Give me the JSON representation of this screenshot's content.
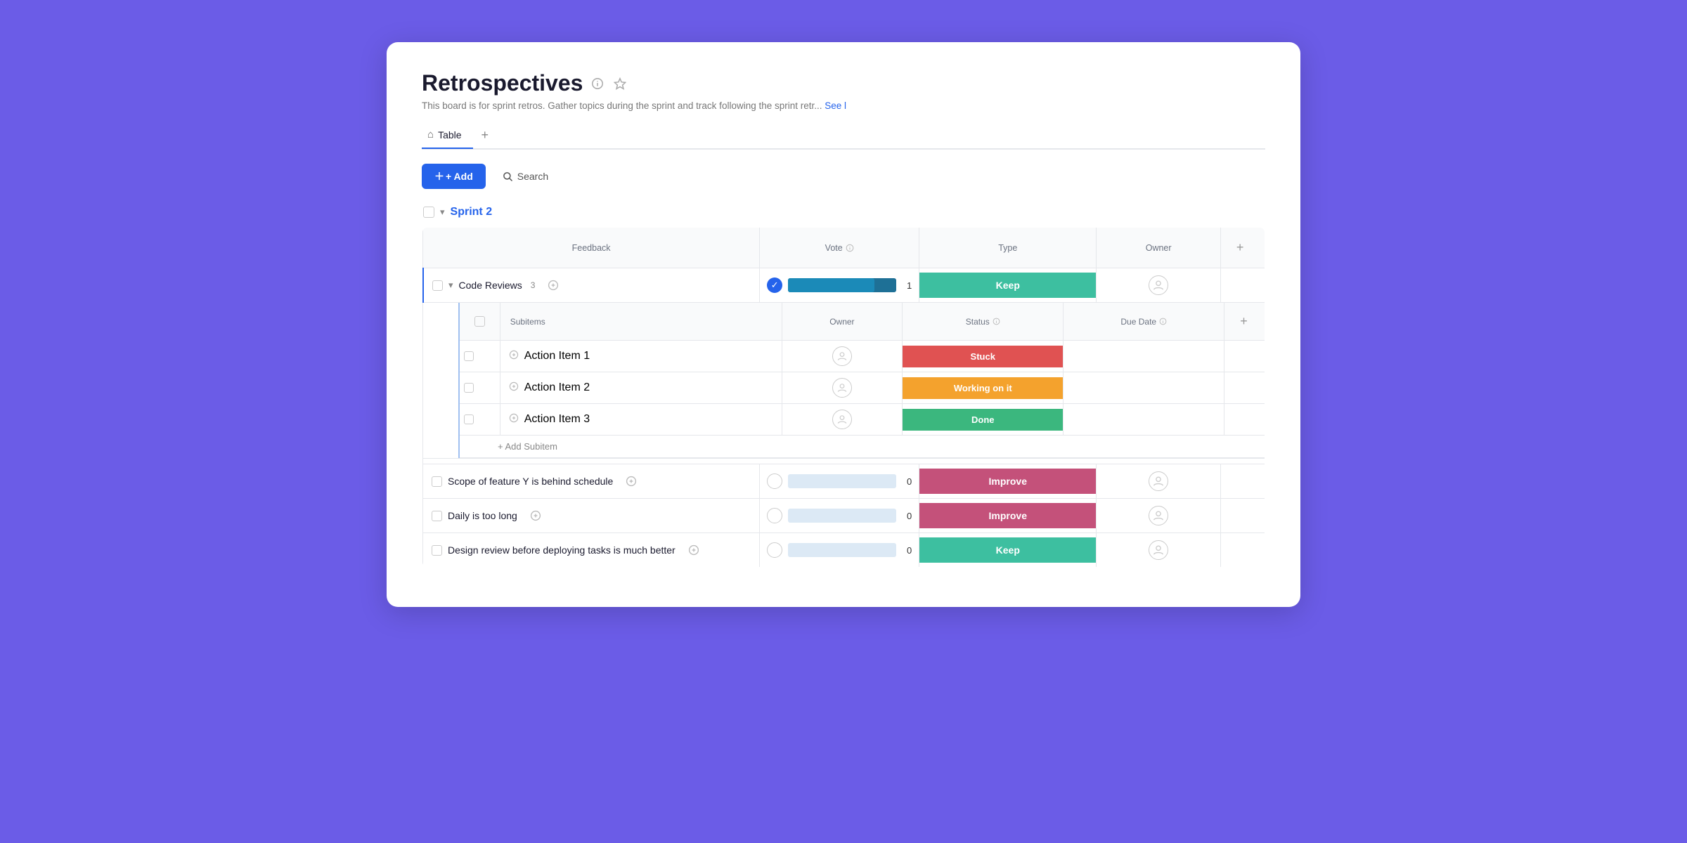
{
  "page": {
    "title": "Retrospectives",
    "description": "This board is for sprint retros. Gather topics during the sprint and track following the sprint retr...",
    "see_more": "See l",
    "tab_label": "Table",
    "add_label": "+ Add",
    "search_label": "Search",
    "add_tab_label": "+"
  },
  "sprint": {
    "name": "Sprint 2",
    "columns": {
      "feedback": "Feedback",
      "vote": "Vote",
      "type": "Type",
      "owner": "Owner",
      "add": "+"
    },
    "main_rows": [
      {
        "id": "code-reviews",
        "label": "Code Reviews",
        "count": "3",
        "vote_value": 1,
        "vote_filled": true,
        "type": "Keep",
        "type_class": "type-keep"
      },
      {
        "id": "scope-feature",
        "label": "Scope of feature Y is behind schedule",
        "count": "",
        "vote_value": 0,
        "vote_filled": false,
        "type": "Improve",
        "type_class": "type-improve"
      },
      {
        "id": "daily-too-long",
        "label": "Daily is too long",
        "count": "",
        "vote_value": 0,
        "vote_filled": false,
        "type": "Improve",
        "type_class": "type-improve"
      },
      {
        "id": "design-review",
        "label": "Design review before deploying tasks is much better",
        "count": "",
        "vote_value": 0,
        "vote_filled": false,
        "type": "Keep",
        "type_class": "type-keep"
      }
    ],
    "subitems": {
      "columns": {
        "name": "Subitems",
        "owner": "Owner",
        "status": "Status",
        "due_date": "Due Date",
        "add": "+"
      },
      "rows": [
        {
          "id": "action-1",
          "label": "Action Item 1",
          "status": "Stuck",
          "status_class": "status-stuck"
        },
        {
          "id": "action-2",
          "label": "Action Item 2",
          "status": "Working on it",
          "status_class": "status-working"
        },
        {
          "id": "action-3",
          "label": "Action Item 3",
          "status": "Done",
          "status_class": "status-done"
        }
      ],
      "add_label": "+ Add Subitem"
    }
  }
}
